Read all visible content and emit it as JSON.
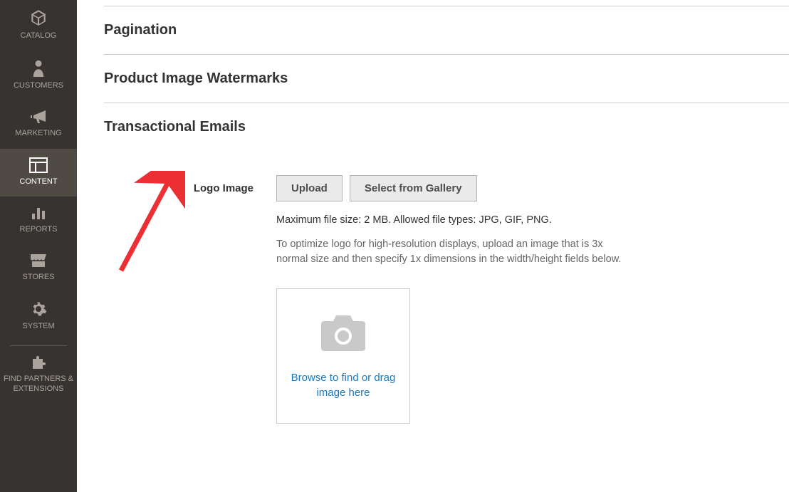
{
  "sidebar": {
    "items": [
      {
        "label": "CATALOG"
      },
      {
        "label": "CUSTOMERS"
      },
      {
        "label": "MARKETING"
      },
      {
        "label": "CONTENT"
      },
      {
        "label": "REPORTS"
      },
      {
        "label": "STORES"
      },
      {
        "label": "SYSTEM"
      },
      {
        "label": "FIND PARTNERS & EXTENSIONS"
      }
    ]
  },
  "sections": {
    "pagination": {
      "title": "Pagination"
    },
    "watermarks": {
      "title": "Product Image Watermarks"
    },
    "emails": {
      "title": "Transactional Emails"
    }
  },
  "logoImage": {
    "label": "Logo Image",
    "uploadBtn": "Upload",
    "galleryBtn": "Select from Gallery",
    "helper1": "Maximum file size: 2 MB. Allowed file types: JPG, GIF, PNG.",
    "helper2": "To optimize logo for high-resolution displays, upload an image that is 3x normal size and then specify 1x dimensions in the width/height fields below.",
    "dropzoneText": "Browse to find or drag image here"
  }
}
